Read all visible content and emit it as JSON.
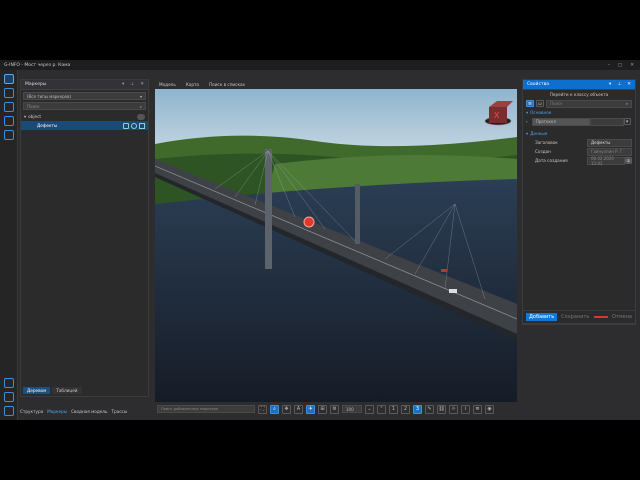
{
  "window": {
    "title": "G-INFO - Мост через р. Кама",
    "min": "–",
    "max": "□",
    "close": "✕"
  },
  "markers": {
    "title": "Маркеры",
    "filter_value": "(Все типы маркеров)",
    "search_placeholder": "Поиск",
    "tree": [
      {
        "label": "object"
      },
      {
        "label": "Дефекты"
      }
    ],
    "tabs": [
      "Деревом",
      "Таблицей"
    ]
  },
  "bottom_tabs": [
    "Структура",
    "Маркеры",
    "Сводная модель",
    "Трассы"
  ],
  "viewport_tabs": [
    "Модель",
    "Карта",
    "Поиск в списках"
  ],
  "viewport_search_placeholder": "Поиск добавленных маркеров",
  "zoom_value": "100",
  "page_numbers": [
    "1",
    "2",
    "3"
  ],
  "properties": {
    "title": "Свойства",
    "goto_class": "Перейти к классу объекта",
    "search_placeholder": "Поиск",
    "section_general": "Основное",
    "status_label": "Протокол",
    "section_data": "Данные",
    "fields": [
      {
        "label": "Заголовок",
        "value": "Дефекты"
      },
      {
        "label": "Создан",
        "value": "Гайнуллин Р. Г."
      },
      {
        "label": "Дата создания",
        "value": "06.02.2020 12:02"
      }
    ],
    "add_button": "Добавить",
    "save_button": "Сохранить",
    "cancel_button": "Отмена"
  },
  "colors": {
    "accent": "#1178d8",
    "panel": "#2b2b2b",
    "marker": "#e03a2a"
  }
}
